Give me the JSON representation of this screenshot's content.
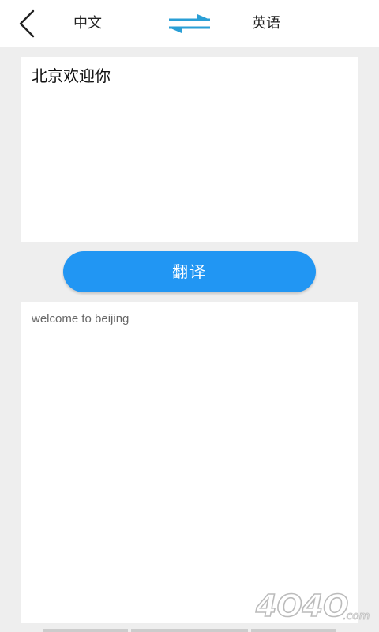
{
  "header": {
    "source_lang": "中文",
    "target_lang": "英语",
    "back_icon": "chevron-left-icon",
    "swap_icon": "swap-arrows-icon",
    "accent_color": "#2196f3"
  },
  "input": {
    "text": "北京欢迎你"
  },
  "translate_button": {
    "label": "翻译",
    "color": "#2196f3"
  },
  "output": {
    "text": "welcome to beijing"
  },
  "watermark": {
    "text": "4O4O",
    "suffix": ".com"
  }
}
